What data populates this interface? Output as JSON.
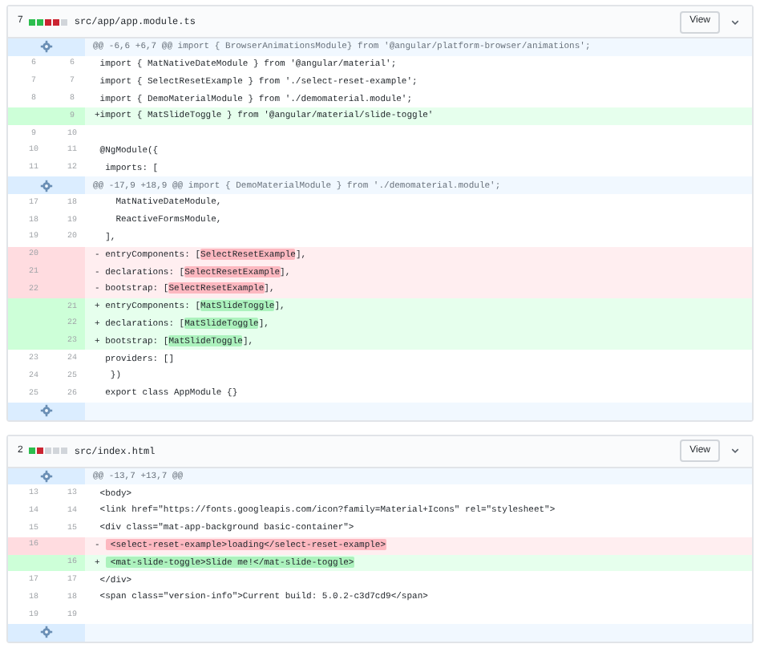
{
  "files": [
    {
      "count": "7",
      "diffstat": [
        {
          "color": "#2cbe4e"
        },
        {
          "color": "#2cbe4e"
        },
        {
          "color": "#cb2431"
        },
        {
          "color": "#cb2431"
        },
        {
          "color": "#d1d5da"
        }
      ],
      "path": "src/app/app.module.ts",
      "view_button": "View",
      "lines": [
        {
          "kind": "hunk",
          "text": "@@ -6,6 +6,7 @@ import { BrowserAnimationsModule} from '@angular/platform-browser/animations';"
        },
        {
          "kind": "context",
          "old": "6",
          "new": "6",
          "parts": [
            {
              "text": " import { MatNativeDateModule } from '@angular/material';",
              "highlight": false
            }
          ]
        },
        {
          "kind": "context",
          "old": "7",
          "new": "7",
          "parts": [
            {
              "text": " import { SelectResetExample } from './select-reset-example';",
              "highlight": false
            }
          ]
        },
        {
          "kind": "context",
          "old": "8",
          "new": "8",
          "parts": [
            {
              "text": " import { DemoMaterialModule } from './demomaterial.module';",
              "highlight": false
            }
          ]
        },
        {
          "kind": "add",
          "new": "9",
          "parts": [
            {
              "text": "+import { MatSlideToggle } from '@angular/material/slide-toggle'",
              "highlight": false
            }
          ]
        },
        {
          "kind": "context",
          "old": "9",
          "new": "10"
        },
        {
          "kind": "context",
          "old": "10",
          "new": "11",
          "parts": [
            {
              "text": " @NgModule({",
              "highlight": false
            }
          ]
        },
        {
          "kind": "context",
          "old": "11",
          "new": "12",
          "parts": [
            {
              "text": "  imports: [",
              "highlight": false
            }
          ]
        },
        {
          "kind": "hunk",
          "text": "@@ -17,9 +18,9 @@ import { DemoMaterialModule } from './demomaterial.module';"
        },
        {
          "kind": "context",
          "old": "17",
          "new": "18",
          "parts": [
            {
              "text": "    MatNativeDateModule,",
              "highlight": false
            }
          ]
        },
        {
          "kind": "context",
          "old": "18",
          "new": "19",
          "parts": [
            {
              "text": "    ReactiveFormsModule,",
              "highlight": false
            }
          ]
        },
        {
          "kind": "context",
          "old": "19",
          "new": "20",
          "parts": [
            {
              "text": "  ],",
              "highlight": false
            }
          ]
        },
        {
          "kind": "del",
          "old": "20",
          "parts": [
            {
              "text": "- entryComponents: [",
              "highlight": false
            },
            {
              "text": "SelectResetExample",
              "highlight": true
            },
            {
              "text": "],",
              "highlight": false
            }
          ]
        },
        {
          "kind": "del",
          "old": "21",
          "parts": [
            {
              "text": "- declarations: [",
              "highlight": false
            },
            {
              "text": "SelectResetExample",
              "highlight": true
            },
            {
              "text": "],",
              "highlight": false
            }
          ]
        },
        {
          "kind": "del",
          "old": "22",
          "parts": [
            {
              "text": "- bootstrap: [",
              "highlight": false
            },
            {
              "text": "SelectResetExample",
              "highlight": true
            },
            {
              "text": "],",
              "highlight": false
            }
          ]
        },
        {
          "kind": "add",
          "new": "21",
          "parts": [
            {
              "text": "+ entryComponents: [",
              "highlight": false
            },
            {
              "text": "MatSlideToggle",
              "highlight": true
            },
            {
              "text": "],",
              "highlight": false
            }
          ]
        },
        {
          "kind": "add",
          "new": "22",
          "parts": [
            {
              "text": "+ declarations: [",
              "highlight": false
            },
            {
              "text": "MatSlideToggle",
              "highlight": true
            },
            {
              "text": "],",
              "highlight": false
            }
          ]
        },
        {
          "kind": "add",
          "new": "23",
          "parts": [
            {
              "text": "+ bootstrap: [",
              "highlight": false
            },
            {
              "text": "MatSlideToggle",
              "highlight": true
            },
            {
              "text": "],",
              "highlight": false
            }
          ]
        },
        {
          "kind": "context",
          "old": "23",
          "new": "24",
          "parts": [
            {
              "text": "  providers: []",
              "highlight": false
            }
          ]
        },
        {
          "kind": "context",
          "old": "24",
          "new": "25",
          "parts": [
            {
              "text": "   })",
              "highlight": false
            }
          ]
        },
        {
          "kind": "context",
          "old": "25",
          "new": "26",
          "parts": [
            {
              "text": "  export class AppModule {}",
              "highlight": false
            }
          ]
        },
        {
          "kind": "expand"
        }
      ]
    },
    {
      "count": "2",
      "diffstat": [
        {
          "color": "#2cbe4e"
        },
        {
          "color": "#cb2431"
        },
        {
          "color": "#d1d5da"
        },
        {
          "color": "#d1d5da"
        },
        {
          "color": "#d1d5da"
        }
      ],
      "path": "src/index.html",
      "view_button": "View",
      "lines": [
        {
          "kind": "hunk",
          "text": "@@ -13,7 +13,7 @@"
        },
        {
          "kind": "context",
          "old": "13",
          "new": "13",
          "parts": [
            {
              "text": " <body>",
              "highlight": false
            }
          ]
        },
        {
          "kind": "context",
          "old": "14",
          "new": "14",
          "parts": [
            {
              "text": " <link href=\"https://fonts.googleapis.com/icon?family=Material+Icons\" rel=\"stylesheet\">",
              "highlight": false
            }
          ]
        },
        {
          "kind": "context",
          "old": "15",
          "new": "15",
          "parts": [
            {
              "text": " <div class=\"mat-app-background basic-container\">",
              "highlight": false
            }
          ]
        },
        {
          "kind": "del",
          "old": "16",
          "parts": [
            {
              "text": "- ",
              "highlight": false
            },
            {
              "text": " <select-reset-example>loading</select-reset-example>",
              "highlight": true
            }
          ]
        },
        {
          "kind": "add",
          "new": "16",
          "parts": [
            {
              "text": "+ ",
              "highlight": false
            },
            {
              "text": " <mat-slide-toggle>Slide me!</mat-slide-toggle>",
              "highlight": true
            }
          ]
        },
        {
          "kind": "context",
          "old": "17",
          "new": "17",
          "parts": [
            {
              "text": " </div>",
              "highlight": false
            }
          ]
        },
        {
          "kind": "context",
          "old": "18",
          "new": "18",
          "parts": [
            {
              "text": " <span class=\"version-info\">Current build: 5.0.2-c3d7cd9</span>",
              "highlight": false
            }
          ]
        },
        {
          "kind": "context",
          "old": "19",
          "new": "19"
        },
        {
          "kind": "expand"
        }
      ]
    }
  ]
}
